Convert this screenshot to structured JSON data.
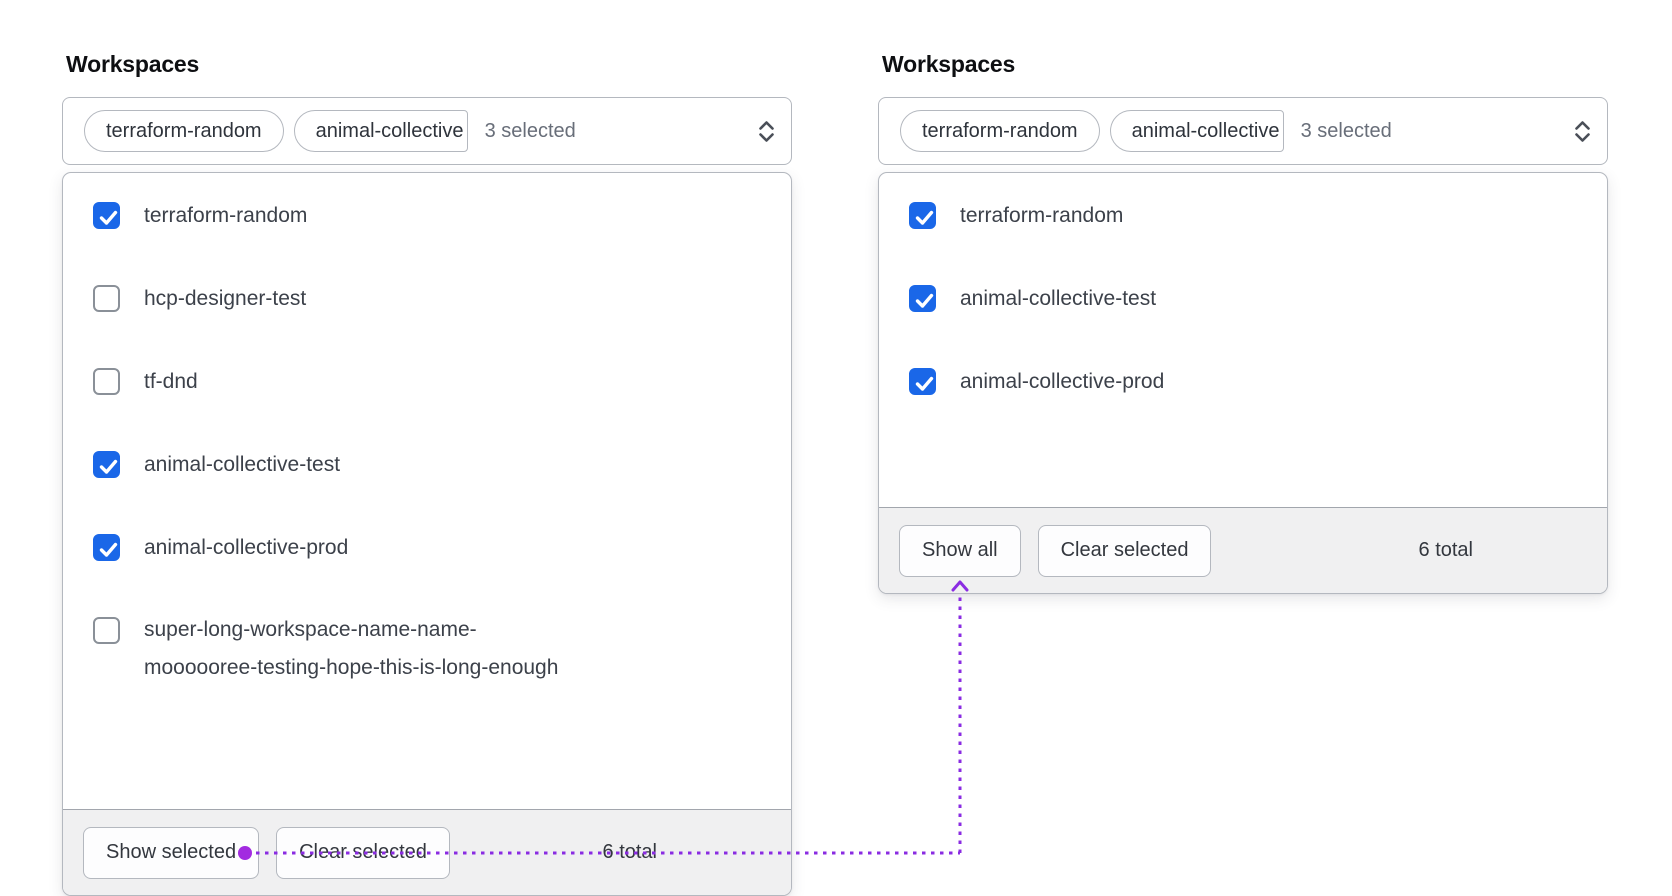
{
  "colors": {
    "accent_blue": "#1a67e8",
    "connector_line": "#8a2be2",
    "connector_dot": "#a22be0",
    "panel_border": "#b4b8bf",
    "footer_bg": "#f0f0f1"
  },
  "left_panel": {
    "label": "Workspaces",
    "trigger": {
      "tags": [
        "terraform-random",
        "animal-collective"
      ],
      "summary": "3 selected"
    },
    "items": [
      {
        "label": "terraform-random",
        "checked": true
      },
      {
        "label": "hcp-designer-test",
        "checked": false
      },
      {
        "label": "tf-dnd",
        "checked": false
      },
      {
        "label": "animal-collective-test",
        "checked": true
      },
      {
        "label": "animal-collective-prod",
        "checked": true
      },
      {
        "label": "super-long-workspace-name-name-moooooree-testing-hope-this-is-long-enough",
        "label_lines": [
          "super-long-workspace-name-name-",
          "moooooree-testing-hope-this-is-long-enough"
        ],
        "checked": false
      }
    ],
    "footer": {
      "show_label": "Show selected",
      "clear_label": "Clear selected",
      "total": "6 total"
    }
  },
  "right_panel": {
    "label": "Workspaces",
    "trigger": {
      "tags": [
        "terraform-random",
        "animal-collective"
      ],
      "summary": "3 selected"
    },
    "items": [
      {
        "label": "terraform-random",
        "checked": true
      },
      {
        "label": "animal-collective-test",
        "checked": true
      },
      {
        "label": "animal-collective-prod",
        "checked": true
      }
    ],
    "footer": {
      "show_label": "Show all",
      "clear_label": "Clear selected",
      "total": "6 total"
    }
  },
  "annotation": {
    "from": "Show selected",
    "to": "Show all"
  }
}
